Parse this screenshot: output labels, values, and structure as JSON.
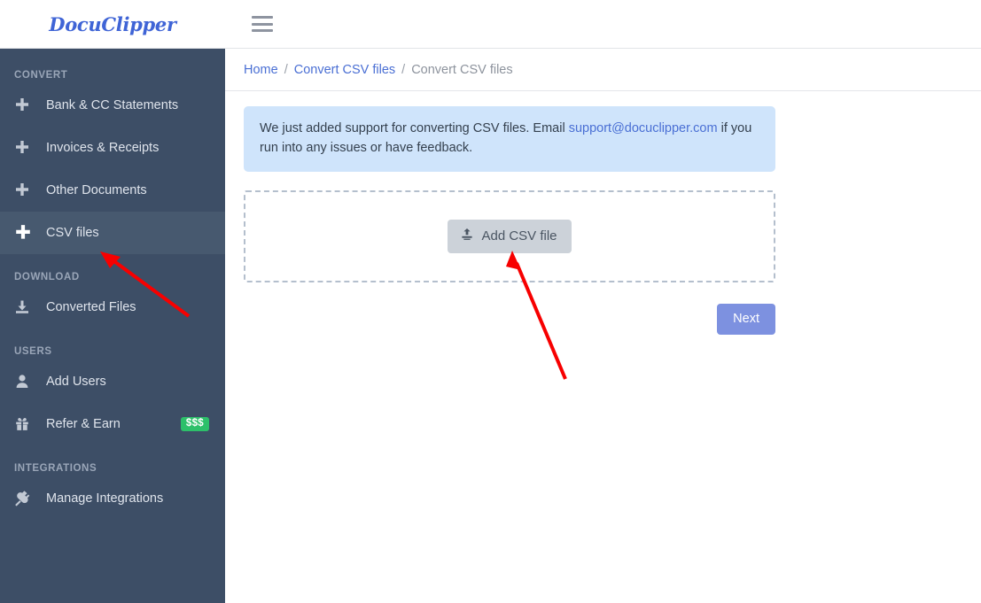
{
  "brand": {
    "name": "DocuClipper"
  },
  "header": {
    "menu_icon": "hamburger-icon"
  },
  "sidebar": {
    "sections": [
      {
        "title": "CONVERT",
        "items": [
          {
            "label": "Bank & CC Statements",
            "icon": "plus-icon",
            "active": false
          },
          {
            "label": "Invoices & Receipts",
            "icon": "plus-icon",
            "active": false
          },
          {
            "label": "Other Documents",
            "icon": "plus-icon",
            "active": false
          },
          {
            "label": "CSV files",
            "icon": "plus-icon",
            "active": true
          }
        ]
      },
      {
        "title": "DOWNLOAD",
        "items": [
          {
            "label": "Converted Files",
            "icon": "download-icon",
            "active": false
          }
        ]
      },
      {
        "title": "USERS",
        "items": [
          {
            "label": "Add Users",
            "icon": "user-icon",
            "active": false
          },
          {
            "label": "Refer & Earn",
            "icon": "gift-icon",
            "active": false,
            "badge": "$$$"
          }
        ]
      },
      {
        "title": "INTEGRATIONS",
        "items": [
          {
            "label": "Manage Integrations",
            "icon": "plug-icon",
            "active": false
          }
        ]
      }
    ]
  },
  "breadcrumb": {
    "home": "Home",
    "separator": "/",
    "parent": "Convert CSV files",
    "current": "Convert CSV files"
  },
  "notice": {
    "text_before": "We just added support for converting CSV files. Email ",
    "email": "support@docuclipper.com",
    "text_after": " if you run into any issues or have feedback."
  },
  "upload": {
    "button_label": "Add CSV file",
    "button_icon": "upload-icon"
  },
  "actions": {
    "next_label": "Next"
  },
  "colors": {
    "sidebar_bg": "#3d4e66",
    "sidebar_active": "#47596f",
    "brand_blue": "#3f64d6",
    "link_blue": "#4a6fd4",
    "notice_bg": "#cfe4fb",
    "next_btn": "#7d91e0",
    "badge_green": "#2dc06a",
    "annotation_red": "#f70000"
  },
  "annotations": [
    {
      "name": "arrow-to-csv-files",
      "color": "#f70000"
    },
    {
      "name": "arrow-to-add-csv-button",
      "color": "#f70000"
    }
  ]
}
